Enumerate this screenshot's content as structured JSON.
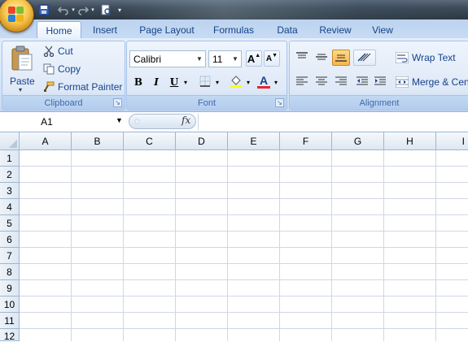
{
  "quick_access": {
    "icons": [
      "office-logo",
      "save-icon",
      "undo-icon",
      "redo-icon",
      "print-preview-icon",
      "customize-icon"
    ]
  },
  "ribbon": {
    "tabs": [
      {
        "label": "Home",
        "active": true
      },
      {
        "label": "Insert"
      },
      {
        "label": "Page Layout"
      },
      {
        "label": "Formulas"
      },
      {
        "label": "Data"
      },
      {
        "label": "Review"
      },
      {
        "label": "View"
      }
    ],
    "clipboard": {
      "group_label": "Clipboard",
      "paste_label": "Paste",
      "cut_label": "Cut",
      "copy_label": "Copy",
      "format_painter_label": "Format Painter"
    },
    "font": {
      "group_label": "Font",
      "font_name": "Calibri",
      "font_size": "11",
      "bold": "B",
      "italic": "I",
      "underline": "U",
      "grow": "A",
      "shrink": "A",
      "font_color_glyph": "A"
    },
    "alignment": {
      "group_label": "Alignment",
      "wrap_text_label": "Wrap Text",
      "merge_label": "Merge & Cent"
    }
  },
  "formula_bar": {
    "name_box": "A1",
    "fx_label": "fx",
    "formula": ""
  },
  "sheet": {
    "columns": [
      "A",
      "B",
      "C",
      "D",
      "E",
      "F",
      "G",
      "H",
      "I"
    ],
    "rows": [
      "1",
      "2",
      "3",
      "4",
      "5",
      "6",
      "7",
      "8",
      "9",
      "10",
      "11",
      "12"
    ]
  },
  "colors": {
    "accent": "#15428b",
    "ribbon_bg": "#d6e5f7",
    "pressed": "#f9b648",
    "font_color_bar": "#e8262a",
    "highlight_bar": "#ffff00"
  }
}
